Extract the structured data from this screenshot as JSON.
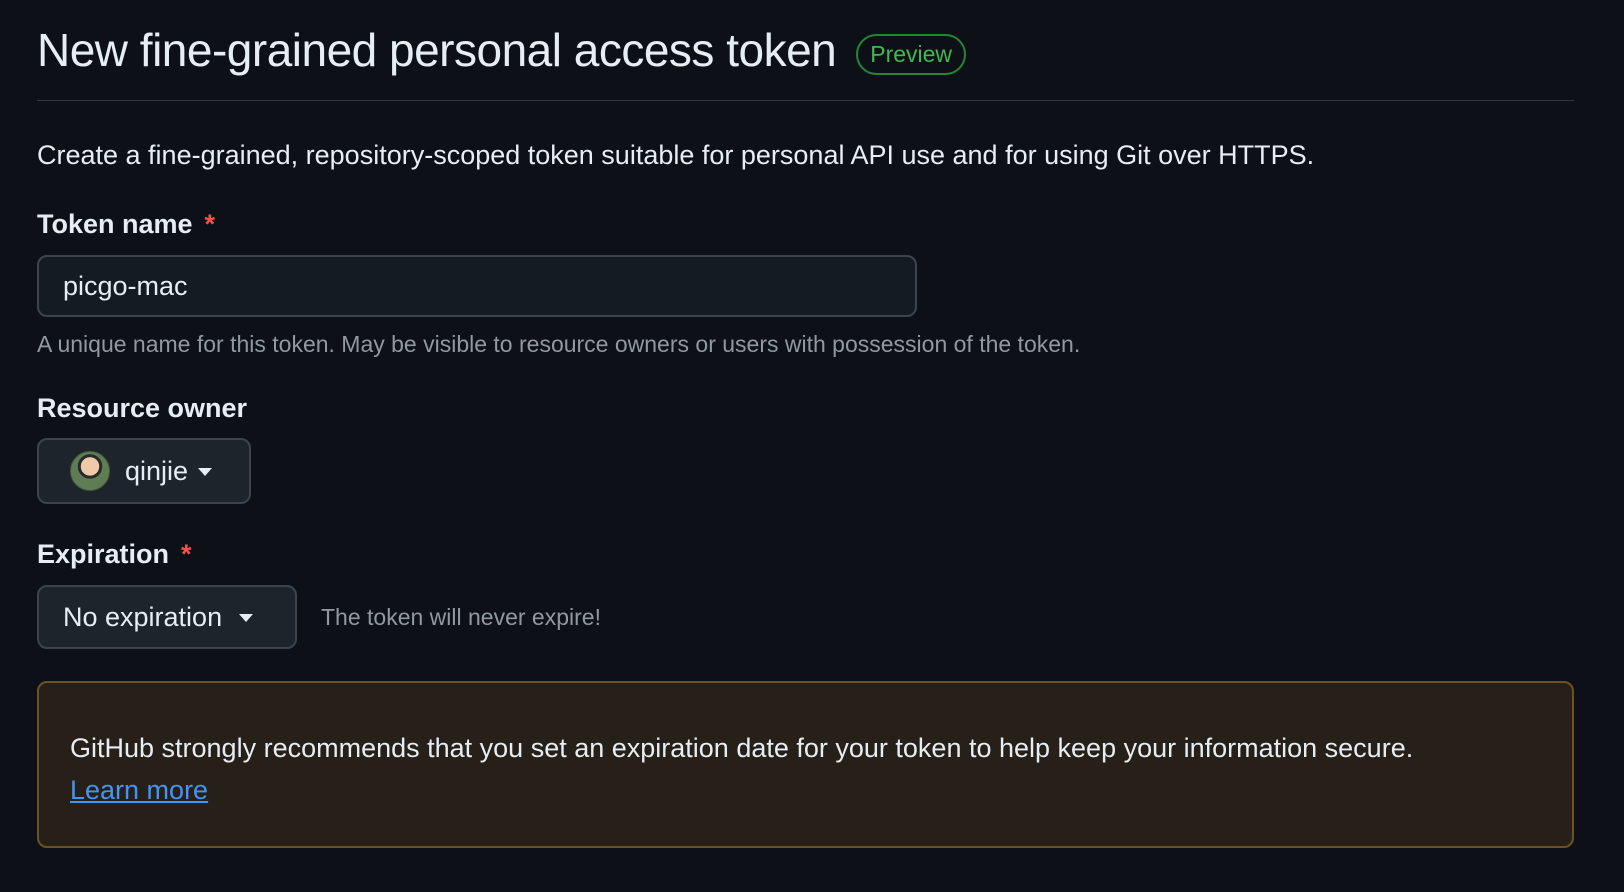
{
  "header": {
    "title": "New fine-grained personal access token",
    "badge": "Preview"
  },
  "description": "Create a fine-grained, repository-scoped token suitable for personal API use and for using Git over HTTPS.",
  "token_name": {
    "label": "Token name",
    "required_mark": "*",
    "value": "picgo-mac",
    "hint": "A unique name for this token. May be visible to resource owners or users with possession of the token."
  },
  "resource_owner": {
    "label": "Resource owner",
    "selected": "qinjie",
    "avatar_icon": "user-avatar"
  },
  "expiration": {
    "label": "Expiration",
    "required_mark": "*",
    "selected": "No expiration",
    "note": "The token will never expire!"
  },
  "warning": {
    "text": "GitHub strongly recommends that you set an expiration date for your token to help keep your information secure.",
    "link": "Learn more"
  },
  "colors": {
    "background": "#0d1117",
    "badge_green": "#3fb950",
    "required_red": "#f85149",
    "link_blue": "#4493f8",
    "warning_bg": "#272019",
    "warning_border": "#6b5220"
  }
}
